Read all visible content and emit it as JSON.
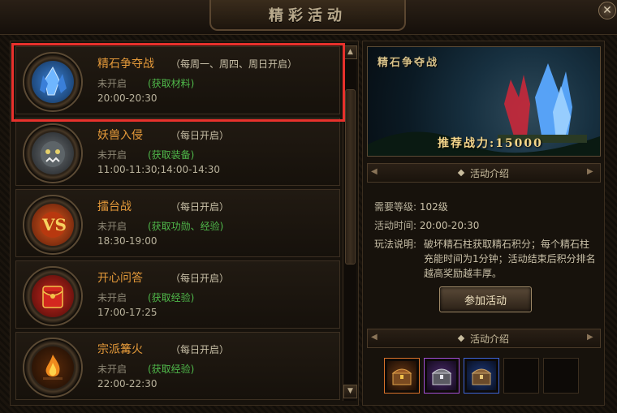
{
  "window": {
    "title": "精彩活动",
    "close_label": "✕"
  },
  "activities": [
    {
      "name": "精石争夺战",
      "schedule": "（每周一、周四、周日开启）",
      "status": "未开启",
      "reward": "(获取材料)",
      "time": "20:00-20:30",
      "icon": "crystal-icon",
      "selected": true
    },
    {
      "name": "妖兽入侵",
      "schedule": "（每日开启）",
      "status": "未开启",
      "reward": "(获取装备)",
      "time": "11:00-11:30;14:00-14:30",
      "icon": "beast-icon",
      "selected": false
    },
    {
      "name": "擂台战",
      "schedule": "（每日开启）",
      "status": "未开启",
      "reward": "(获取功勋、经验)",
      "time": "18:30-19:00",
      "icon": "versus-icon",
      "selected": false
    },
    {
      "name": "开心问答",
      "schedule": "（每日开启）",
      "status": "未开启",
      "reward": "(获取经验)",
      "time": "17:00-17:25",
      "icon": "red-envelope-icon",
      "selected": false
    },
    {
      "name": "宗派篝火",
      "schedule": "（每日开启）",
      "status": "未开启",
      "reward": "(获取经验)",
      "time": "22:00-22:30",
      "icon": "bonfire-icon",
      "selected": false
    }
  ],
  "detail": {
    "banner_title": "精石争夺战",
    "banner_power": "推荐战力:15000",
    "section_intro": "活动介绍",
    "level_label": "需要等级:",
    "level_value": "102级",
    "time_label": "活动时间:",
    "time_value": "20:00-20:30",
    "rules_label": "玩法说明:",
    "rules_value": "破坏精石柱获取精石积分；每个精石柱充能时间为1分钟；活动结束后积分排名越高奖励越丰厚。",
    "join_label": "参加活动",
    "section_rewards": "活动介绍"
  },
  "rewards": [
    {
      "icon": "treasure-chest-orange-icon",
      "color": "#d9722a"
    },
    {
      "icon": "treasure-chest-purple-icon",
      "color": "#a24fd6"
    },
    {
      "icon": "treasure-chest-blue-icon",
      "color": "#3d63d6"
    },
    {
      "icon": "empty-slot",
      "color": "#0d0a07"
    },
    {
      "icon": "empty-slot",
      "color": "#0d0a07"
    }
  ],
  "colors": {
    "accent_name": "#e59a3a",
    "reward_green": "#4fb84a",
    "highlight_red": "#e8312c"
  }
}
